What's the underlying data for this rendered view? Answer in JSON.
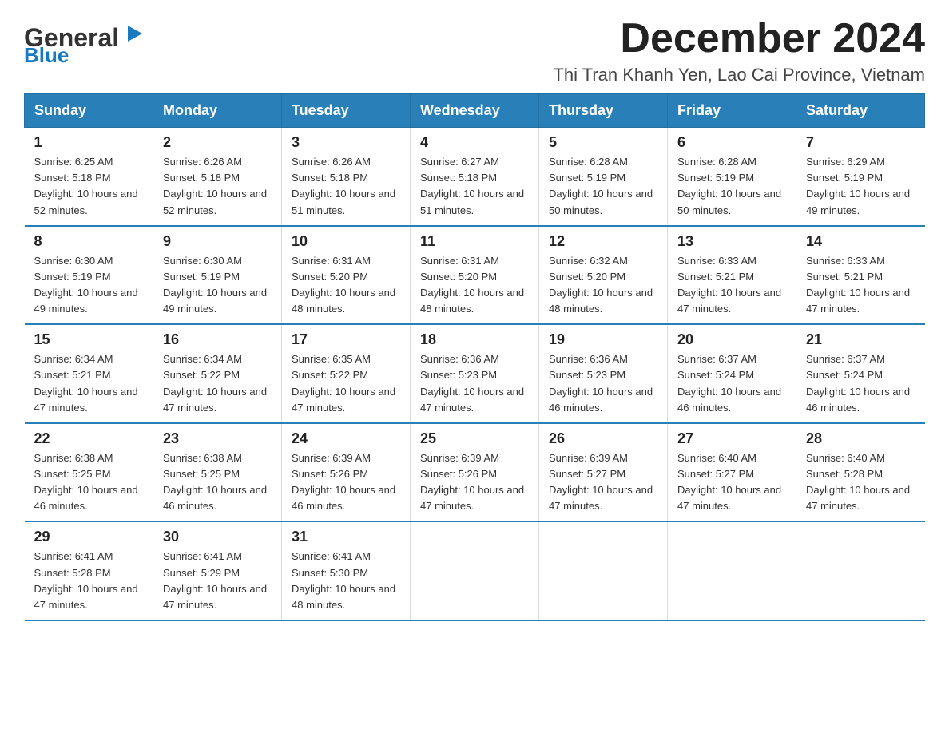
{
  "logo": {
    "text_general": "General",
    "text_blue": "Blue"
  },
  "header": {
    "month_title": "December 2024",
    "subtitle": "Thi Tran Khanh Yen, Lao Cai Province, Vietnam"
  },
  "days_of_week": [
    "Sunday",
    "Monday",
    "Tuesday",
    "Wednesday",
    "Thursday",
    "Friday",
    "Saturday"
  ],
  "weeks": [
    [
      {
        "day": "1",
        "sunrise": "6:25 AM",
        "sunset": "5:18 PM",
        "daylight": "10 hours and 52 minutes."
      },
      {
        "day": "2",
        "sunrise": "6:26 AM",
        "sunset": "5:18 PM",
        "daylight": "10 hours and 52 minutes."
      },
      {
        "day": "3",
        "sunrise": "6:26 AM",
        "sunset": "5:18 PM",
        "daylight": "10 hours and 51 minutes."
      },
      {
        "day": "4",
        "sunrise": "6:27 AM",
        "sunset": "5:18 PM",
        "daylight": "10 hours and 51 minutes."
      },
      {
        "day": "5",
        "sunrise": "6:28 AM",
        "sunset": "5:19 PM",
        "daylight": "10 hours and 50 minutes."
      },
      {
        "day": "6",
        "sunrise": "6:28 AM",
        "sunset": "5:19 PM",
        "daylight": "10 hours and 50 minutes."
      },
      {
        "day": "7",
        "sunrise": "6:29 AM",
        "sunset": "5:19 PM",
        "daylight": "10 hours and 49 minutes."
      }
    ],
    [
      {
        "day": "8",
        "sunrise": "6:30 AM",
        "sunset": "5:19 PM",
        "daylight": "10 hours and 49 minutes."
      },
      {
        "day": "9",
        "sunrise": "6:30 AM",
        "sunset": "5:19 PM",
        "daylight": "10 hours and 49 minutes."
      },
      {
        "day": "10",
        "sunrise": "6:31 AM",
        "sunset": "5:20 PM",
        "daylight": "10 hours and 48 minutes."
      },
      {
        "day": "11",
        "sunrise": "6:31 AM",
        "sunset": "5:20 PM",
        "daylight": "10 hours and 48 minutes."
      },
      {
        "day": "12",
        "sunrise": "6:32 AM",
        "sunset": "5:20 PM",
        "daylight": "10 hours and 48 minutes."
      },
      {
        "day": "13",
        "sunrise": "6:33 AM",
        "sunset": "5:21 PM",
        "daylight": "10 hours and 47 minutes."
      },
      {
        "day": "14",
        "sunrise": "6:33 AM",
        "sunset": "5:21 PM",
        "daylight": "10 hours and 47 minutes."
      }
    ],
    [
      {
        "day": "15",
        "sunrise": "6:34 AM",
        "sunset": "5:21 PM",
        "daylight": "10 hours and 47 minutes."
      },
      {
        "day": "16",
        "sunrise": "6:34 AM",
        "sunset": "5:22 PM",
        "daylight": "10 hours and 47 minutes."
      },
      {
        "day": "17",
        "sunrise": "6:35 AM",
        "sunset": "5:22 PM",
        "daylight": "10 hours and 47 minutes."
      },
      {
        "day": "18",
        "sunrise": "6:36 AM",
        "sunset": "5:23 PM",
        "daylight": "10 hours and 47 minutes."
      },
      {
        "day": "19",
        "sunrise": "6:36 AM",
        "sunset": "5:23 PM",
        "daylight": "10 hours and 46 minutes."
      },
      {
        "day": "20",
        "sunrise": "6:37 AM",
        "sunset": "5:24 PM",
        "daylight": "10 hours and 46 minutes."
      },
      {
        "day": "21",
        "sunrise": "6:37 AM",
        "sunset": "5:24 PM",
        "daylight": "10 hours and 46 minutes."
      }
    ],
    [
      {
        "day": "22",
        "sunrise": "6:38 AM",
        "sunset": "5:25 PM",
        "daylight": "10 hours and 46 minutes."
      },
      {
        "day": "23",
        "sunrise": "6:38 AM",
        "sunset": "5:25 PM",
        "daylight": "10 hours and 46 minutes."
      },
      {
        "day": "24",
        "sunrise": "6:39 AM",
        "sunset": "5:26 PM",
        "daylight": "10 hours and 46 minutes."
      },
      {
        "day": "25",
        "sunrise": "6:39 AM",
        "sunset": "5:26 PM",
        "daylight": "10 hours and 47 minutes."
      },
      {
        "day": "26",
        "sunrise": "6:39 AM",
        "sunset": "5:27 PM",
        "daylight": "10 hours and 47 minutes."
      },
      {
        "day": "27",
        "sunrise": "6:40 AM",
        "sunset": "5:27 PM",
        "daylight": "10 hours and 47 minutes."
      },
      {
        "day": "28",
        "sunrise": "6:40 AM",
        "sunset": "5:28 PM",
        "daylight": "10 hours and 47 minutes."
      }
    ],
    [
      {
        "day": "29",
        "sunrise": "6:41 AM",
        "sunset": "5:28 PM",
        "daylight": "10 hours and 47 minutes."
      },
      {
        "day": "30",
        "sunrise": "6:41 AM",
        "sunset": "5:29 PM",
        "daylight": "10 hours and 47 minutes."
      },
      {
        "day": "31",
        "sunrise": "6:41 AM",
        "sunset": "5:30 PM",
        "daylight": "10 hours and 48 minutes."
      },
      null,
      null,
      null,
      null
    ]
  ],
  "labels": {
    "sunrise": "Sunrise:",
    "sunset": "Sunset:",
    "daylight": "Daylight:"
  }
}
